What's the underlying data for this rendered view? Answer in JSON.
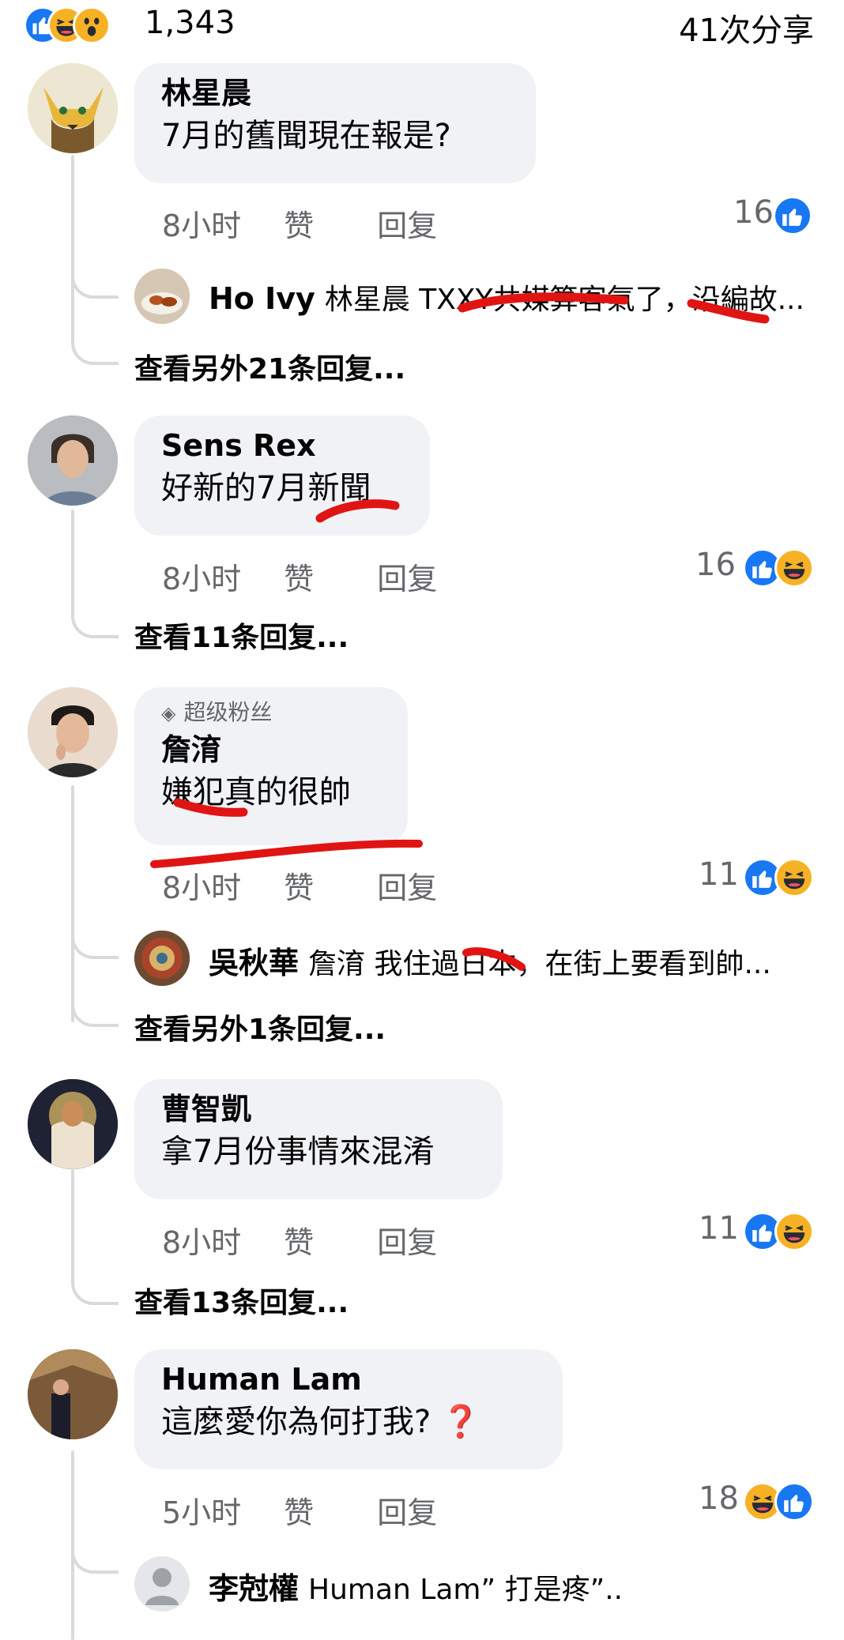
{
  "top": {
    "reaction_icons": [
      "like-icon",
      "haha-icon",
      "wow-icon"
    ],
    "reaction_count": "1,343",
    "share_count": "41次分享"
  },
  "colors": {
    "like_blue": "#1877f2",
    "bubble_bg": "#f0f2f5",
    "meta_grey": "#65676b",
    "scribble_red": "#e11414",
    "haha_yellow": "#f7b125"
  },
  "labels": {
    "like": "赞",
    "reply": "回复"
  },
  "comments": [
    {
      "author": "林星晨",
      "text": "7月的舊聞現在報是?",
      "time": "8小时",
      "reactions": "16",
      "reaction_icons": [
        "like-icon"
      ],
      "reply": {
        "author": "Ho Ivy",
        "text": "林星晨 TXXY共媒算客氣了，沿編故..."
      },
      "more": "查看另外21条回复..."
    },
    {
      "author": "Sens Rex",
      "text": "好新的7月新聞",
      "time": "8小时",
      "reactions": "16",
      "reaction_icons": [
        "like-icon",
        "haha-icon"
      ],
      "more": "查看11条回复..."
    },
    {
      "badge": "超级粉丝",
      "author": "詹淯",
      "text": "嫌犯真的很帥",
      "time": "8小时",
      "reactions": "11",
      "reaction_icons": [
        "like-icon",
        "haha-icon"
      ],
      "reply": {
        "author": "吳秋華",
        "text": "詹淯 我住過日本，在街上要看到帥..."
      },
      "more": "查看另外1条回复..."
    },
    {
      "author": "曹智凱",
      "text": "拿7月份事情來混淆",
      "time": "8小时",
      "reactions": "11",
      "reaction_icons": [
        "like-icon",
        "haha-icon"
      ],
      "more": "查看13条回复..."
    },
    {
      "author": "Human Lam",
      "text": "這麼愛你為何打我?",
      "text_emoji": "❓",
      "time": "5小时",
      "reactions": "18",
      "reaction_icons": [
        "haha-icon",
        "like-icon"
      ],
      "reply": {
        "author": "李尅權",
        "text": "Human Lam” 打是疼”.."
      }
    }
  ]
}
